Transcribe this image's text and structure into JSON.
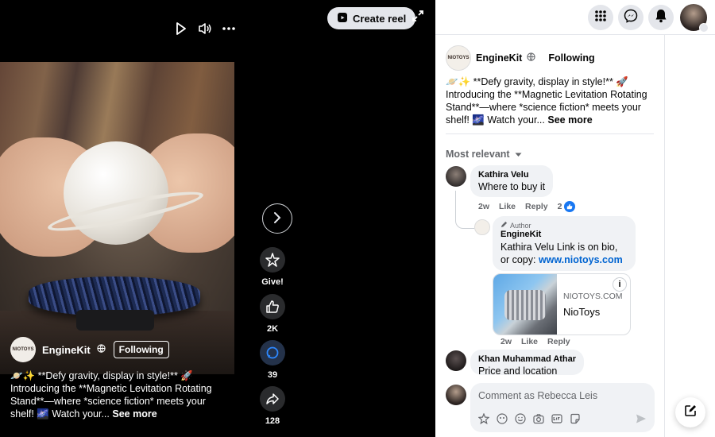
{
  "viewer": {
    "create_reel_label": "Create reel",
    "icons": [
      "play-icon",
      "volume-icon",
      "more-icon",
      "expand-icon",
      "next-icon"
    ],
    "actions": {
      "give_label": "Give!",
      "like_count": "2K",
      "comment_count": "39",
      "share_count": "128"
    },
    "owner": {
      "avatar_text": "NIOTOYS",
      "name": "EngineKit",
      "follow_label": "Following"
    },
    "caption": {
      "text": "🪐✨ **Defy gravity, display in style!** 🚀 Introducing the **Magnetic Levitation Rotating Stand**—where *science fiction* meets your shelf! 🌌 Watch your...",
      "more": "See more"
    }
  },
  "panel": {
    "post": {
      "author": "EngineKit",
      "follow_label": "Following",
      "avatar_text": "NIOTOYS",
      "text": "🪐✨ **Defy gravity, display in style!** 🚀 Introducing the **Magnetic Levitation Rotating Stand**—where *science fiction* meets your shelf! 🌌 Watch your...",
      "more": "See more"
    },
    "sort_label": "Most relevant",
    "comments": [
      {
        "name": "Kathira Velu",
        "text": "Where to buy it",
        "time": "2w",
        "like": "Like",
        "reply": "Reply",
        "reactions": "2"
      },
      {
        "tag": "Author",
        "name": "EngineKit",
        "text": "Kathira Velu Link is on bio, or copy: ",
        "link": "www.niotoys.com",
        "time": "2w",
        "like": "Like",
        "reply": "Reply",
        "card": {
          "domain": "NIOTOYS.COM",
          "title": "NioToys"
        }
      },
      {
        "name": "Khan Muhammad Athar",
        "text": "Price and location"
      }
    ],
    "composer_placeholder": "Comment as Rebecca Leis",
    "accent": "#1877f2"
  }
}
